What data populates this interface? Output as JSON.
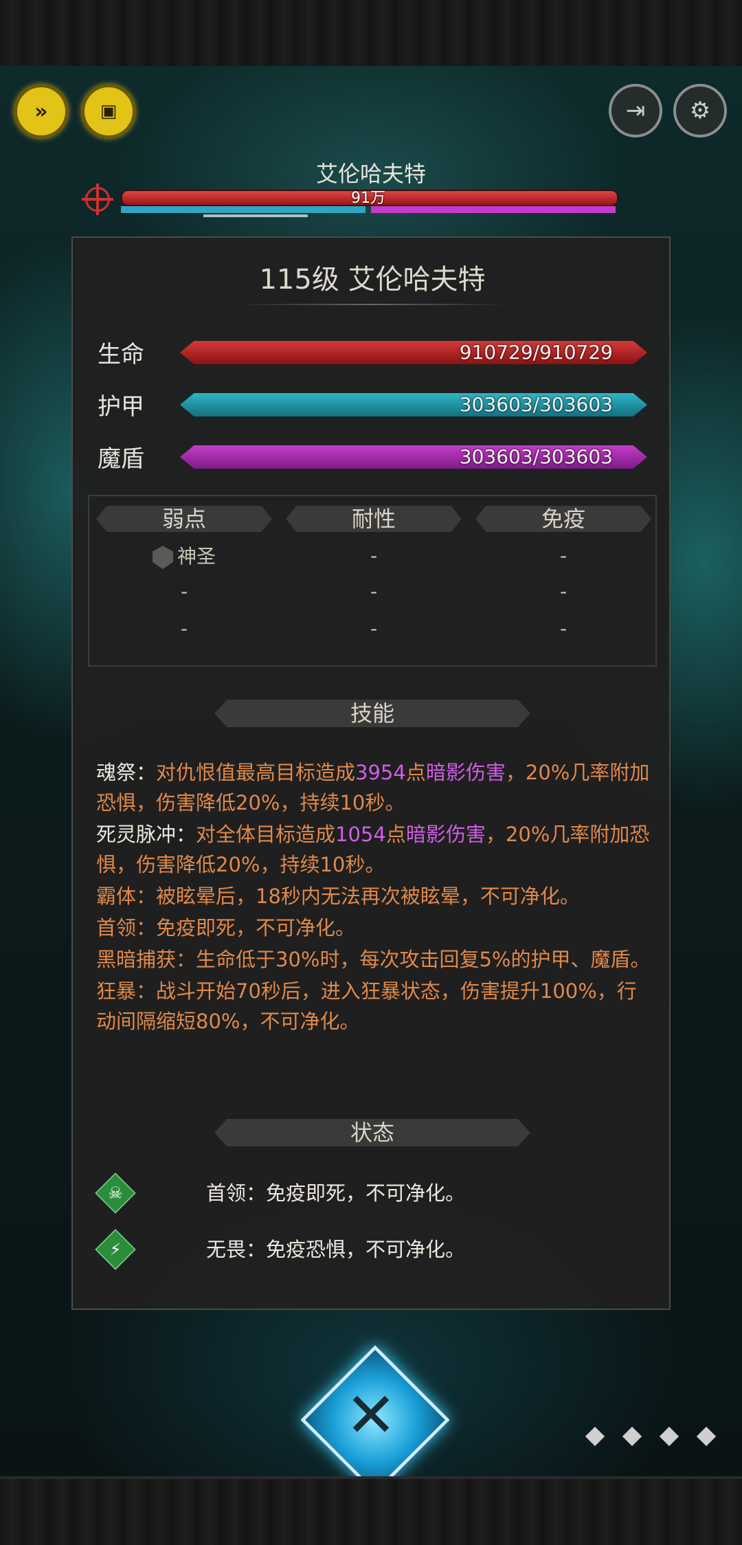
{
  "top": {
    "boss_name": "艾伦哈夫特",
    "hp_short": "91万"
  },
  "buttons": {
    "fast_forward_icon": "fast-forward-icon",
    "auto_icon": "monitor-icon",
    "exit_icon": "exit-icon",
    "settings_icon": "gear-icon"
  },
  "panel": {
    "title": "115级  艾伦哈夫特",
    "stats": [
      {
        "label": "生命",
        "value": "910729/910729",
        "fill": 1.0
      },
      {
        "label": "护甲",
        "value": "303603/303603",
        "fill": 1.0
      },
      {
        "label": "魔盾",
        "value": "303603/303603",
        "fill": 1.0
      }
    ],
    "resist": {
      "headers": [
        "弱点",
        "耐性",
        "免疫"
      ],
      "weak": [
        "神圣",
        "-",
        "-"
      ],
      "resist": [
        "-",
        "-",
        "-"
      ],
      "immune": [
        "-",
        "-",
        "-"
      ]
    },
    "skills_header": "技能",
    "skills": [
      {
        "segs": [
          [
            "w",
            "魂祭："
          ],
          [
            "o",
            "对仇恨值最高目标造成"
          ],
          [
            "p",
            "3954"
          ],
          [
            "o",
            "点"
          ],
          [
            "p",
            "暗影伤害"
          ],
          [
            "o",
            "，20%几率附加恐惧，伤害降低20%，持续10秒。"
          ]
        ]
      },
      {
        "segs": [
          [
            "w",
            "死灵脉冲："
          ],
          [
            "o",
            "对全体目标造成"
          ],
          [
            "p",
            "1054"
          ],
          [
            "o",
            "点"
          ],
          [
            "p",
            "暗影伤害"
          ],
          [
            "o",
            "，20%几率附加恐惧，伤害降低20%，持续10秒。"
          ]
        ]
      },
      {
        "segs": [
          [
            "o",
            "霸体：被眩晕后，18秒内无法再次被眩晕，不可净化。"
          ]
        ]
      },
      {
        "segs": [
          [
            "o",
            "首领：免疫即死，不可净化。"
          ]
        ]
      },
      {
        "segs": [
          [
            "o",
            "黑暗捕获：生命低于30%时，每次攻击回复5%的护甲、魔盾。"
          ]
        ]
      },
      {
        "segs": [
          [
            "o",
            "狂暴：战斗开始70秒后，进入狂暴状态，伤害提升100%，行动间隔缩短80%，不可净化。"
          ]
        ]
      }
    ],
    "status_header": "状态",
    "statuses": [
      {
        "icon": "skull-icon",
        "text": "首领：免疫即死，不可净化。"
      },
      {
        "icon": "fearless-icon",
        "text": "无畏：免疫恐惧，不可净化。"
      }
    ]
  },
  "colors": {
    "hp": "#d63a3a",
    "armor": "#2fb6c6",
    "shield": "#c43ec8",
    "skill_orange": "#e0894a",
    "skill_purple": "#cf5fe6"
  }
}
